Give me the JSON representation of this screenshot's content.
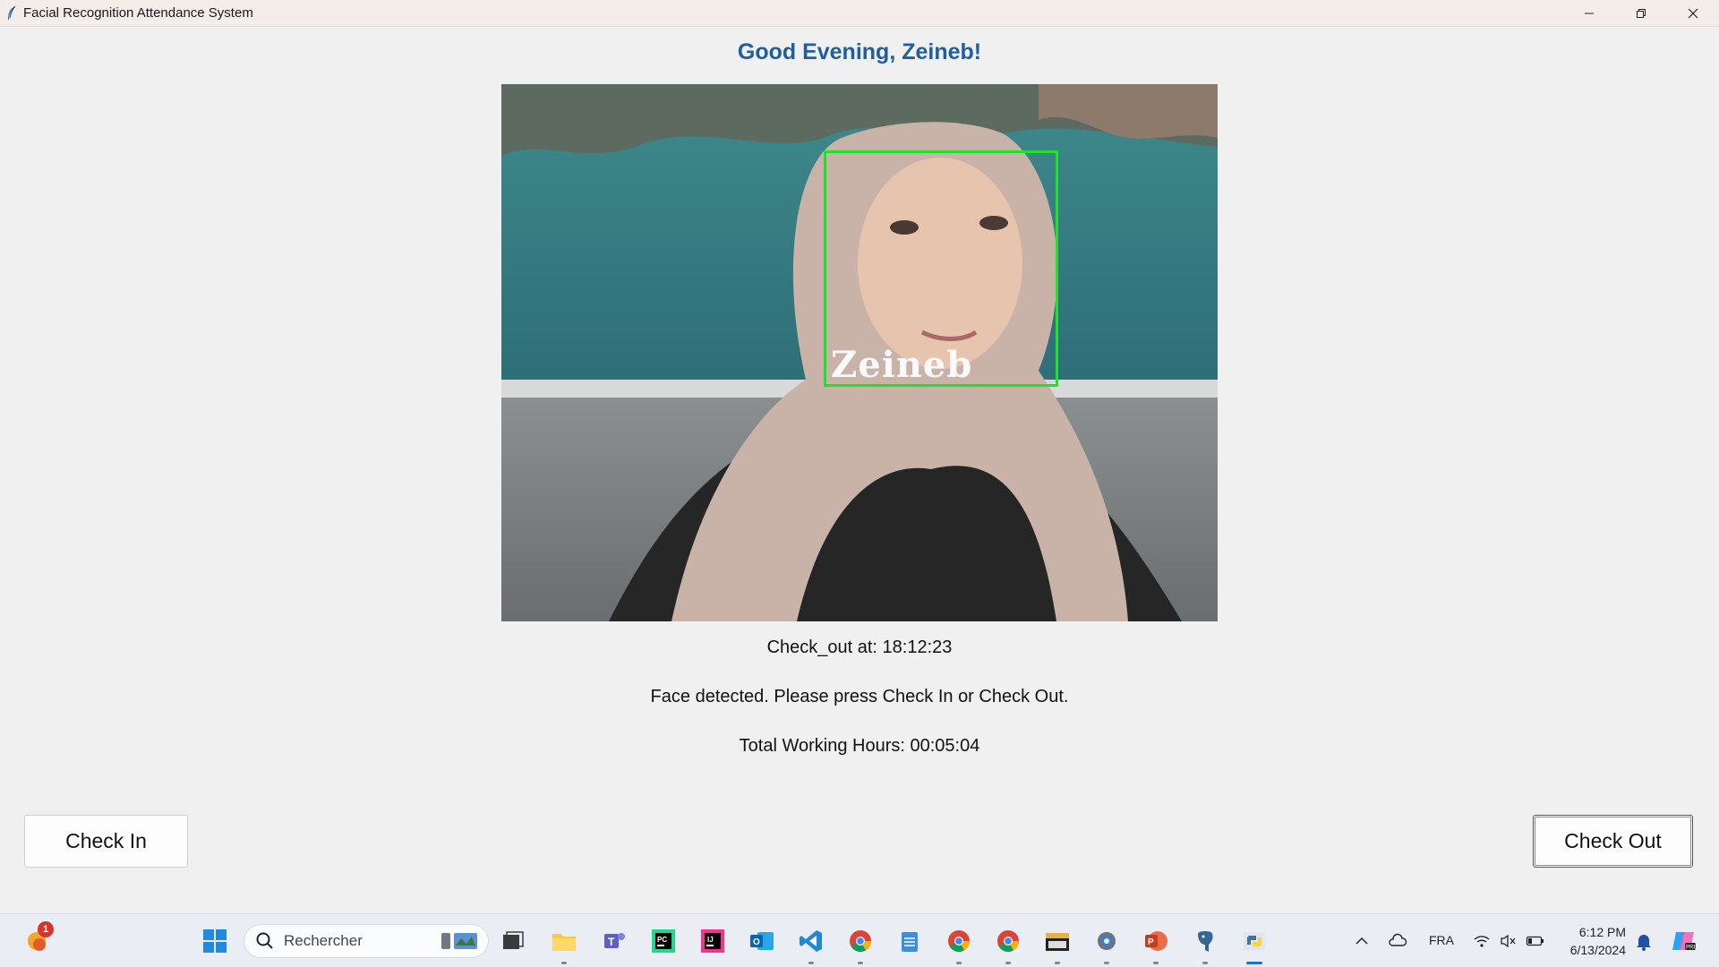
{
  "window": {
    "title": "Facial Recognition Attendance System",
    "controls": {
      "minimize_icon": "minimize-icon",
      "restore_icon": "restore-icon",
      "close_icon": "close-icon"
    }
  },
  "main": {
    "greeting": "Good Evening, Zeineb!",
    "camera": {
      "detected_name": "Zeineb",
      "box_color": "#22e12a"
    },
    "status": {
      "last_action": "Check_out at: 18:12:23",
      "message": "Face detected. Please press Check In or Check Out.",
      "total_hours": "Total Working Hours: 00:05:04"
    },
    "buttons": {
      "check_in": "Check In",
      "check_out": "Check Out"
    }
  },
  "taskbar": {
    "search_placeholder": "Rechercher",
    "notification_count": "1",
    "language": "FRA",
    "time": "6:12 PM",
    "date": "6/13/2024",
    "apps": [
      "weather",
      "start",
      "search",
      "task-view",
      "file-explorer",
      "teams",
      "pycharm",
      "intellij",
      "outlook",
      "vscode",
      "chrome",
      "notepad",
      "chrome",
      "chrome",
      "file-manager",
      "settings",
      "powerpoint",
      "postgresql",
      "python"
    ]
  },
  "colors": {
    "greeting": "#1f5f9f",
    "accent": "#1f6fd6"
  }
}
